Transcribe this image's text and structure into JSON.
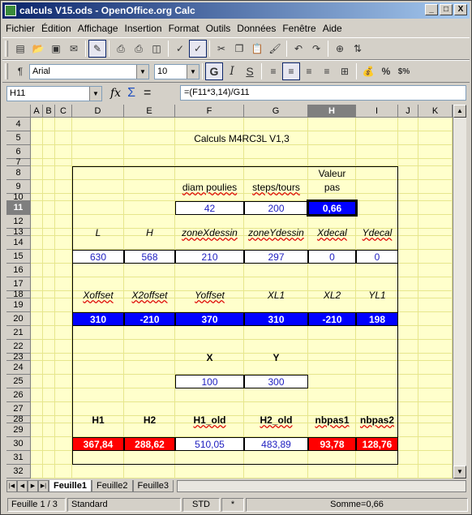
{
  "window": {
    "title": "calculs V15.ods - OpenOffice.org Calc",
    "minimize": "_",
    "maximize": "□",
    "close": "X"
  },
  "menu": [
    "Fichier",
    "Édition",
    "Affichage",
    "Insertion",
    "Format",
    "Outils",
    "Données",
    "Fenêtre",
    "Aide"
  ],
  "toolbar2": {
    "font_name": "Arial",
    "font_size": "10",
    "bold": "G",
    "italic": "I",
    "underline": "S",
    "percent": "%",
    "currency": "$%"
  },
  "formula_bar": {
    "name_box": "H11",
    "sum": "Σ",
    "equals": "=",
    "formula": "=(F11*3,14)/G11"
  },
  "columns": [
    "A",
    "B",
    "C",
    "D",
    "E",
    "F",
    "G",
    "H",
    "I",
    "J",
    "K"
  ],
  "rows": [
    "4",
    "5",
    "6",
    "7",
    "8",
    "9",
    "10",
    "11",
    "12",
    "13",
    "14",
    "15",
    "16",
    "17",
    "18",
    "19",
    "20",
    "21",
    "22",
    "23",
    "24",
    "25",
    "26",
    "27",
    "28",
    "29",
    "30",
    "31",
    "32"
  ],
  "sheet": {
    "title": "Calculs M4RC3L V1,3",
    "valeur": "Valeur",
    "pas": "pas",
    "diam_label": "diam poulies",
    "steps_label": "steps/tours",
    "diam": "42",
    "steps": "200",
    "pas_val": "0,66",
    "labels_row13": [
      "L",
      "H",
      "zoneXdessin",
      "zoneYdessin",
      "Xdecal",
      "Ydecal"
    ],
    "values_row15": [
      "630",
      "568",
      "210",
      "297",
      "0",
      "0"
    ],
    "labels_row18": [
      "Xoffset",
      "X2offset",
      "Yoffset",
      "XL1",
      "XL2",
      "YL1"
    ],
    "values_row20": [
      "310",
      "-210",
      "370",
      "310",
      "-210",
      "198"
    ],
    "x_label": "X",
    "y_label": "Y",
    "x_val": "100",
    "y_val": "300",
    "labels_row28": [
      "H1",
      "H2",
      "H1_old",
      "H2_old",
      "nbpas1",
      "nbpas2"
    ],
    "values_row30": [
      "367,84",
      "288,62",
      "510,05",
      "483,89",
      "93,78",
      "128,76"
    ]
  },
  "tabs": [
    "Feuille1",
    "Feuille2",
    "Feuille3"
  ],
  "status": {
    "sheet": "Feuille 1 / 3",
    "style": "Standard",
    "mode": "STD",
    "modified": "*",
    "sum": "Somme=0,66"
  },
  "colors": {
    "blue_cell": "#0000ff",
    "red_cell": "#ff0000",
    "grid_bg": "#ffffcc",
    "value_text": "#2020c0"
  }
}
